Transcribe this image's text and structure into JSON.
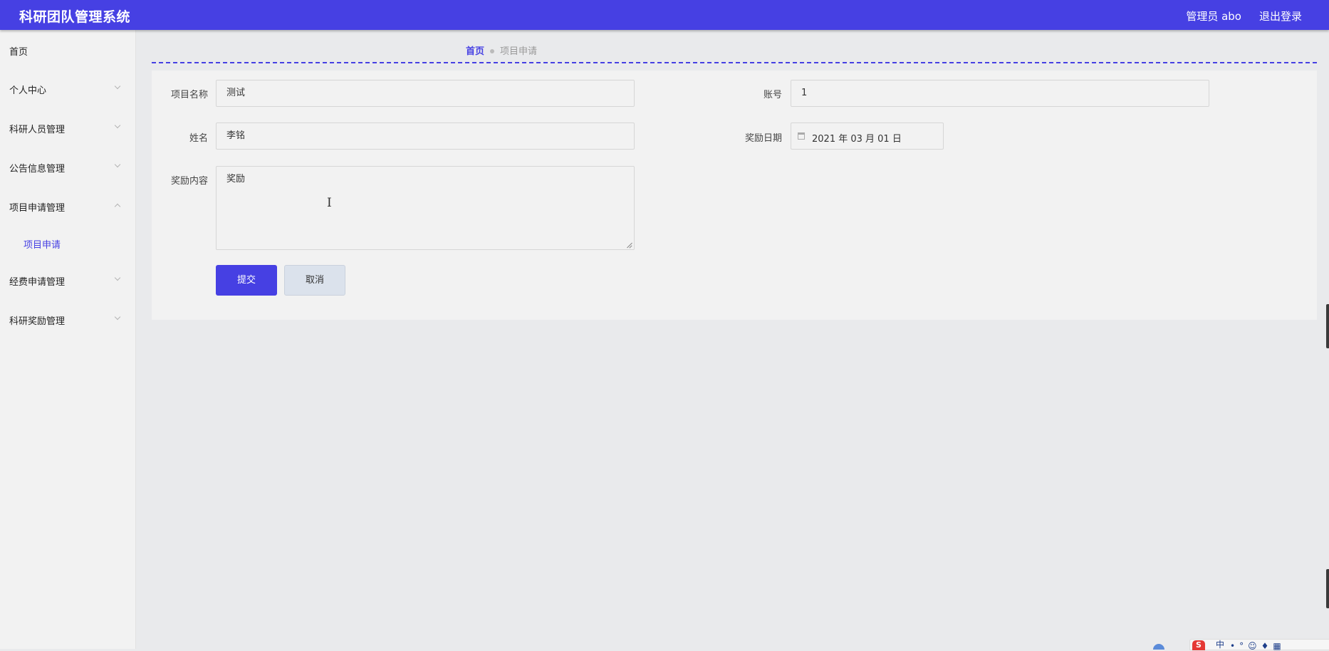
{
  "header": {
    "app_title": "科研团队管理系统",
    "admin_label": "管理员 abo",
    "logout_label": "退出登录",
    "bg_color": "#4640e3"
  },
  "sidebar": {
    "items": [
      {
        "label": "首页",
        "chevron": "none"
      },
      {
        "label": "个人中心",
        "chevron": "chevron-down-icon"
      },
      {
        "label": "科研人员管理",
        "chevron": "chevron-down-icon"
      },
      {
        "label": "公告信息管理",
        "chevron": "chevron-down-icon"
      },
      {
        "label": "项目申请管理",
        "chevron": "chevron-up-icon",
        "expanded": true
      },
      {
        "label": "经费申请管理",
        "chevron": "chevron-down-icon"
      },
      {
        "label": "科研奖励管理",
        "chevron": "chevron-down-icon"
      }
    ],
    "subitem_active": "项目申请"
  },
  "breadcrumb": {
    "home": "首页",
    "current": "项目申请"
  },
  "form": {
    "project_name_label": "项目名称",
    "project_name_value": "测试",
    "account_label": "账号",
    "account_value": "1",
    "name_label": "姓名",
    "name_value": "李铭",
    "award_date_label": "奖励日期",
    "award_date_value": "2021 年 03 月 01 日",
    "award_content_label": "奖励内容",
    "award_content_value": "奖励"
  },
  "buttons": {
    "submit": "提交",
    "cancel": "取消"
  },
  "taskbar": {
    "ime_logo": "S",
    "ime_mode": "中"
  },
  "colors": {
    "accent": "#4640e3",
    "page_bg": "#e9eaec",
    "panel_bg": "#f2f2f2"
  }
}
